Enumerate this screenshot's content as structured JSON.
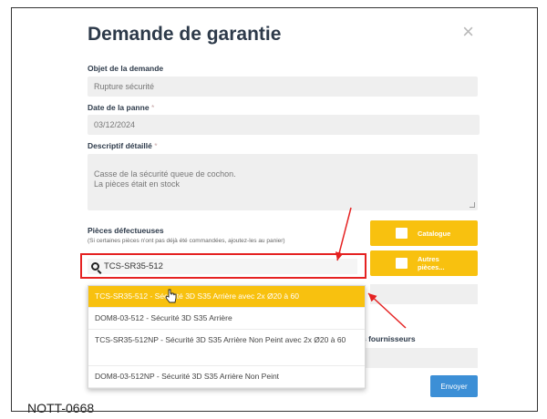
{
  "modal": {
    "title": "Demande de garantie",
    "close_glyph": "×"
  },
  "form": {
    "subject": {
      "label": "Objet de la demande",
      "value": "Rupture sécurité"
    },
    "date": {
      "label": "Date de la panne",
      "required_mark": "*",
      "value": "03/12/2024"
    },
    "description": {
      "label": "Descriptif détaillé",
      "required_mark": "*",
      "value": "Casse de la sécurité queue de cochon.\nLa pièces était en stock"
    },
    "parts": {
      "label": "Pièces défectueuses",
      "hint": "(Si certaines pièces n'ont pas déjà été commandées, ajoutez-les au panier)",
      "search_value": "TCS-SR35-512",
      "catalogue_label": "Catalogue",
      "other_parts_label": "Autres pièces..."
    },
    "suppliers_label": "s fournisseurs",
    "send_label": "Envoyer"
  },
  "dropdown": {
    "options": [
      {
        "text": "TCS-SR35-512 - Sécurité 3D S35 Arrière avec 2x Ø20 à 60",
        "active": true
      },
      {
        "text": "DOM8-03-512 - Sécurité 3D S35 Arrière",
        "active": false
      },
      {
        "text": "TCS-SR35-512NP - Sécurité 3D S35 Arrière Non Peint avec 2x Ø20 à 60",
        "active": false
      },
      {
        "text": "DOM8-03-512NP - Sécurité 3D S35 Arrière Non Peint",
        "active": false
      }
    ]
  },
  "footer": {
    "code": "NOTT-0668"
  },
  "icons": {
    "search": "search-icon",
    "catalogue": "book-icon",
    "other_parts": "box-icon",
    "cursor": "hand-cursor-icon"
  },
  "colors": {
    "accent_yellow": "#f8c10f",
    "send_blue": "#3c8fd6",
    "annotation_red": "#e52222"
  }
}
